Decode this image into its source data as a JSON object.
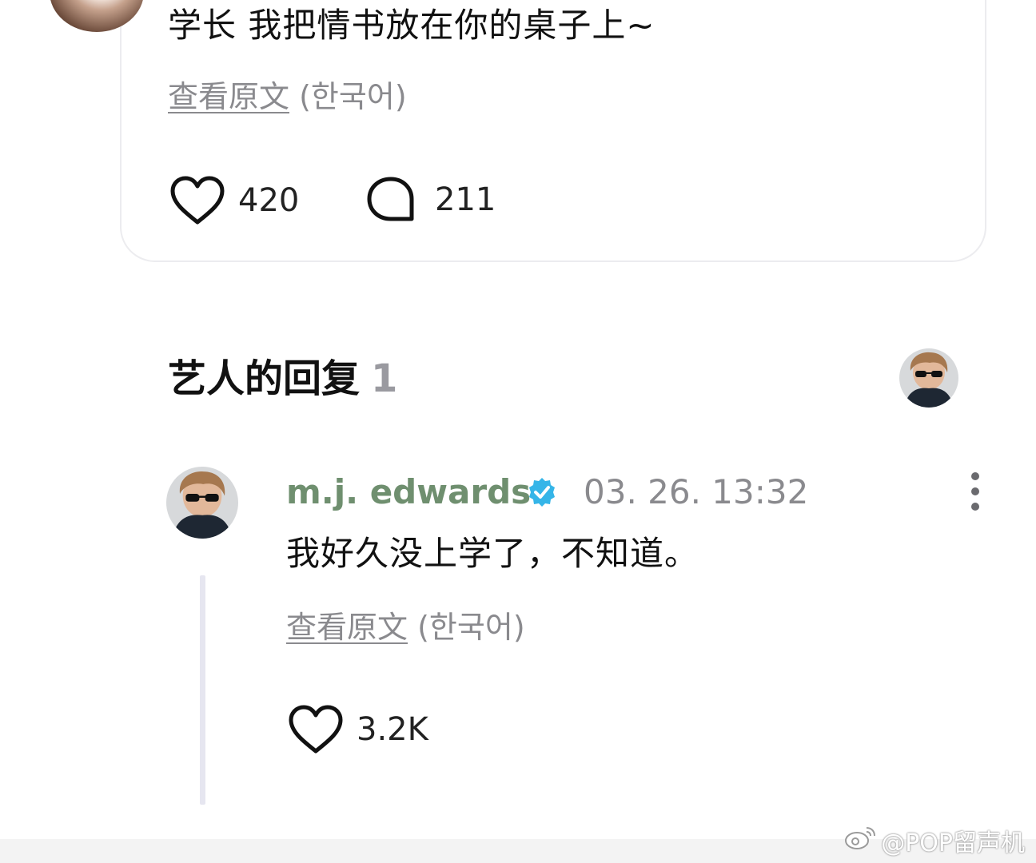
{
  "post": {
    "text": "学长 我把情书放在你的桌子上~",
    "view_original": "查看原文",
    "language": "(한국어)",
    "likes": "420",
    "comments": "211"
  },
  "artist_replies": {
    "title": "艺人的回复",
    "count": "1"
  },
  "reply": {
    "author": "m.j. edwards",
    "time": "03. 26. 13:32",
    "text": "我好久没上学了，不知道。",
    "view_original": "查看原文",
    "language": "(한국어)",
    "likes": "3.2K"
  },
  "watermark": "@POP留声机",
  "colors": {
    "author_green": "#6f8f6f",
    "verified_blue": "#35b5e8",
    "muted_gray": "#8a8a8e"
  },
  "icons": [
    "heart-icon",
    "comment-bubble-icon",
    "verified-badge-icon",
    "more-vertical-icon"
  ]
}
